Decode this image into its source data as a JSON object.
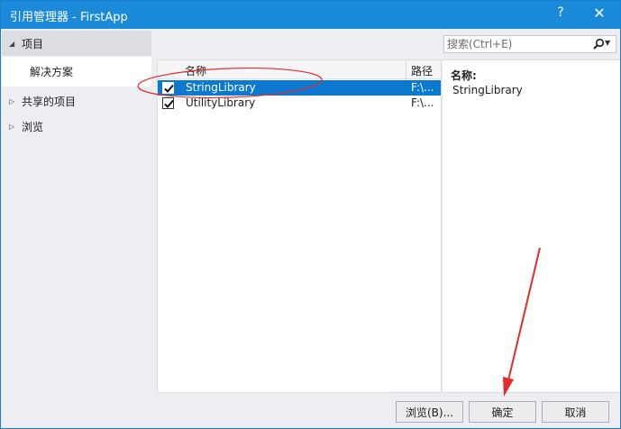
{
  "window": {
    "title": "引用管理器 - FirstApp",
    "help_glyph": "?",
    "close_glyph": "✕"
  },
  "nav": {
    "project": "项目",
    "solution": "解决方案",
    "shared": "共享的项目",
    "browse": "浏览"
  },
  "search": {
    "placeholder": "搜索(Ctrl+E)"
  },
  "list": {
    "headers": {
      "name": "名称",
      "path": "路径"
    },
    "rows": [
      {
        "name": "StringLibrary",
        "path": "F:\\...",
        "checked": true,
        "selected": true
      },
      {
        "name": "UtilityLibrary",
        "path": "F:\\...",
        "checked": true,
        "selected": false
      }
    ]
  },
  "details": {
    "label": "名称:",
    "value": "StringLibrary"
  },
  "buttons": {
    "browse": "浏览(B)...",
    "ok": "确定",
    "cancel": "取消"
  },
  "colors": {
    "accent": "#1a8ad9",
    "selection": "#0a79cf",
    "annotation": "#e52c2c"
  }
}
